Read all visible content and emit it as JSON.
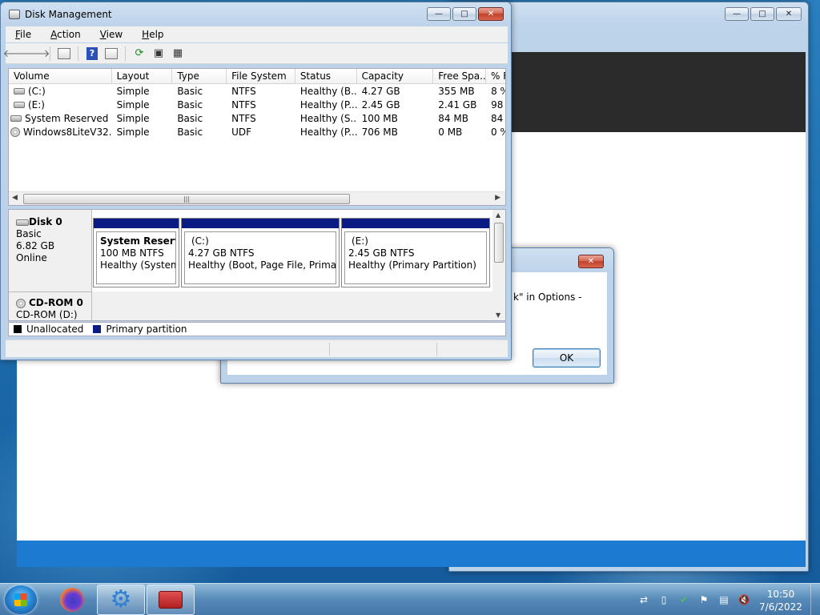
{
  "colors": {
    "partition_bar": "#0a1b84",
    "unallocated": "#000000",
    "primary": "#0a1b84",
    "taskbar_accent": "#1c7bd0"
  },
  "disk_management": {
    "title": "Disk Management",
    "menu": [
      {
        "label": "File",
        "u": "F",
        "rest": "ile"
      },
      {
        "label": "Action",
        "u": "A",
        "rest": "ction"
      },
      {
        "label": "View",
        "u": "V",
        "rest": "iew"
      },
      {
        "label": "Help",
        "u": "H",
        "rest": "elp"
      }
    ],
    "toolbar_icons": [
      "back-arrow-icon",
      "forward-arrow-icon",
      "show-hide-tree-icon",
      "help-icon",
      "properties-icon",
      "refresh-icon",
      "rescan-icon",
      "export-list-icon"
    ],
    "columns": [
      "Volume",
      "Layout",
      "Type",
      "File System",
      "Status",
      "Capacity",
      "Free Spa...",
      "% F"
    ],
    "volumes": [
      {
        "volume": "(C:)",
        "layout": "Simple",
        "type": "Basic",
        "fs": "NTFS",
        "status": "Healthy (B...",
        "capacity": "4.27 GB",
        "free": "355 MB",
        "pct": "8 %",
        "icon": "disk"
      },
      {
        "volume": "(E:)",
        "layout": "Simple",
        "type": "Basic",
        "fs": "NTFS",
        "status": "Healthy (P...",
        "capacity": "2.45 GB",
        "free": "2.41 GB",
        "pct": "98",
        "icon": "disk"
      },
      {
        "volume": "System Reserved",
        "layout": "Simple",
        "type": "Basic",
        "fs": "NTFS",
        "status": "Healthy (S...",
        "capacity": "100 MB",
        "free": "84 MB",
        "pct": "84",
        "icon": "disk"
      },
      {
        "volume": "Windows8LiteV32...",
        "layout": "Simple",
        "type": "Basic",
        "fs": "UDF",
        "status": "Healthy (P...",
        "capacity": "706 MB",
        "free": "0 MB",
        "pct": "0 %",
        "icon": "cd"
      }
    ],
    "disk0": {
      "name": "Disk 0",
      "kind": "Basic",
      "size": "6.82 GB",
      "state": "Online",
      "partitions": [
        {
          "name": "System Reservec",
          "size": "100 MB NTFS",
          "status": "Healthy (System, A"
        },
        {
          "name": "(C:)",
          "size": "4.27 GB NTFS",
          "status": "Healthy (Boot, Page File, Primary P"
        },
        {
          "name": "(E:)",
          "size": "2.45 GB NTFS",
          "status": "Healthy (Primary Partition)"
        }
      ]
    },
    "cdrom0": {
      "name": "CD-ROM 0",
      "drive": "CD-ROM (D:)"
    },
    "legend": {
      "unallocated": "Unallocated",
      "primary": "Primary partition"
    }
  },
  "message_box": {
    "text": "k\" in Options -",
    "ok_label": "OK"
  },
  "taskbar": {
    "apps": [
      "firefox-icon",
      "settings-gears-icon",
      "toolbox-icon"
    ],
    "tray_icons": [
      "network-icon",
      "usb-icon",
      "security-shield-icon",
      "action-center-flag-icon",
      "display-icon",
      "volume-muted-icon"
    ],
    "time": "10:50",
    "date": "7/6/2022"
  }
}
